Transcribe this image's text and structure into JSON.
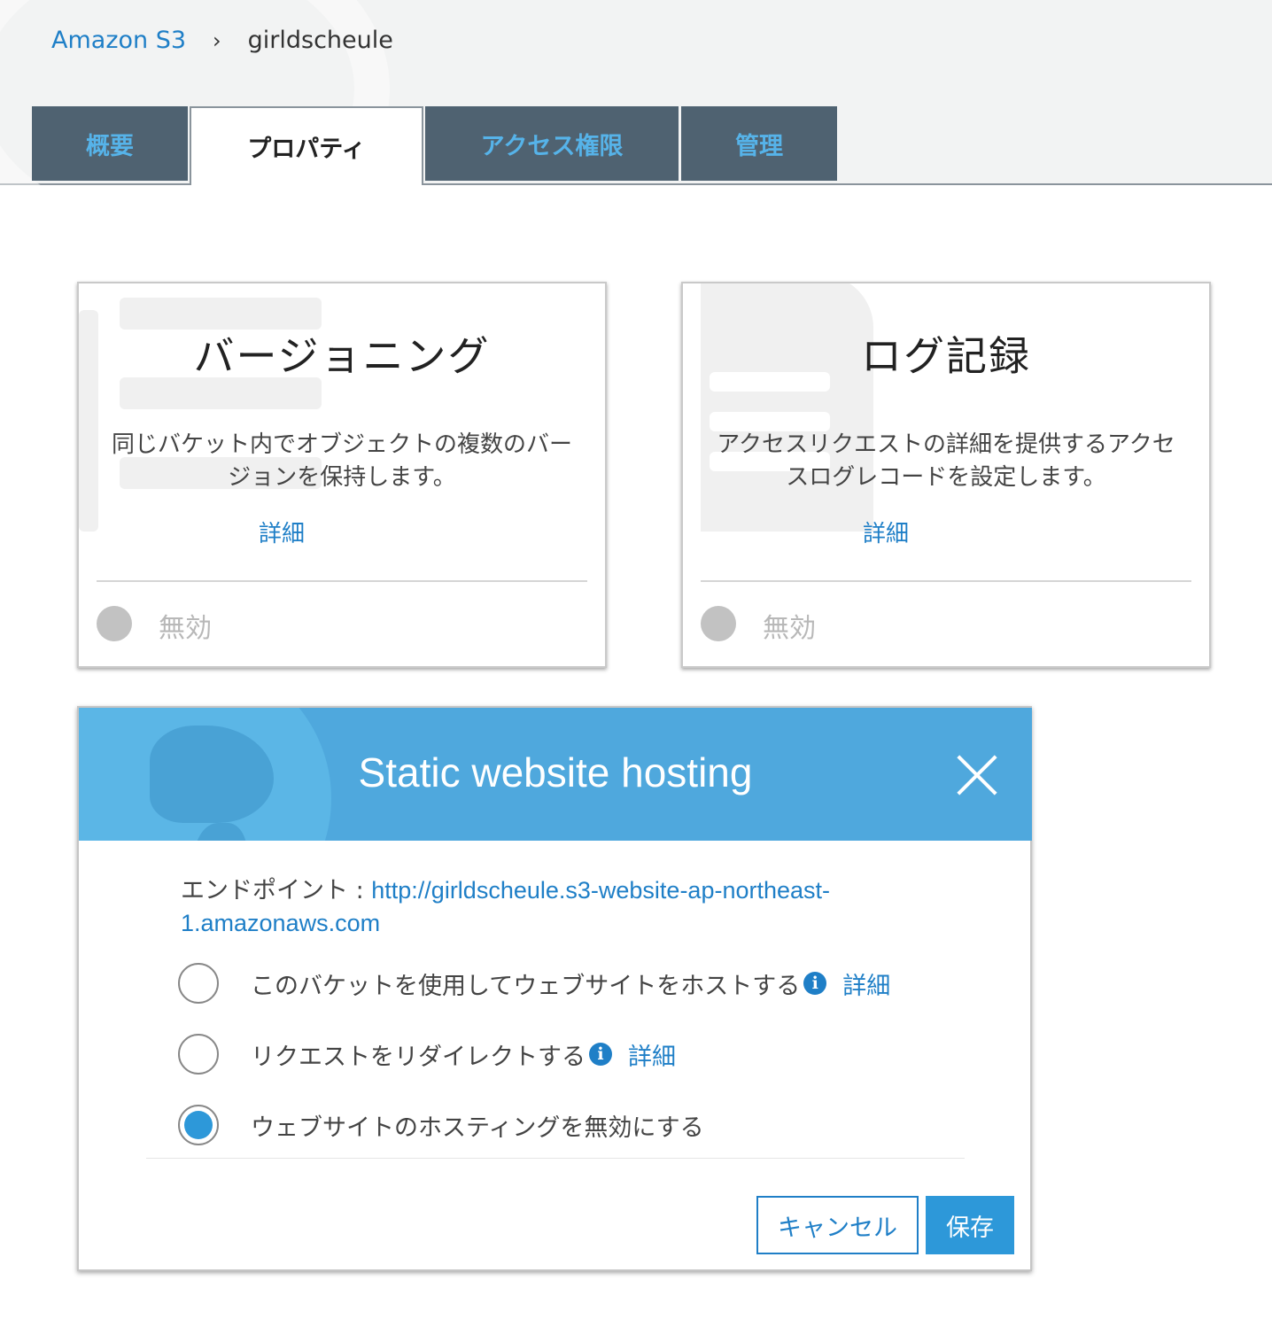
{
  "breadcrumb": {
    "root": "Amazon S3",
    "separator": "›",
    "current": "girldscheule"
  },
  "tabs": [
    {
      "label": "概要",
      "active": false
    },
    {
      "label": "プロパティ",
      "active": true
    },
    {
      "label": "アクセス権限",
      "active": false
    },
    {
      "label": "管理",
      "active": false
    }
  ],
  "cards": {
    "versioning": {
      "title": "バージョニング",
      "description": "同じバケット内でオブジェクトの複数のバージョンを保持します。",
      "more": "詳細",
      "status": "無効"
    },
    "logging": {
      "title": "ログ記録",
      "description": "アクセスリクエストの詳細を提供するアクセスログレコードを設定します。",
      "more": "詳細",
      "status": "無効"
    }
  },
  "modal": {
    "title": "Static website hosting",
    "endpoint_label": "エンドポイント : ",
    "endpoint_url": "http://girldscheule.s3-website-ap-northeast-1.amazonaws.com",
    "options": [
      {
        "label": "このバケットを使用してウェブサイトをホストする",
        "more": "詳細",
        "info_icon": "i",
        "checked": false
      },
      {
        "label": "リクエストをリダイレクトする",
        "more": "詳細",
        "info_icon": "i",
        "checked": false
      },
      {
        "label": "ウェブサイトのホスティングを無効にする",
        "checked": true
      }
    ],
    "cancel_label": "キャンセル",
    "save_label": "保存"
  },
  "colors": {
    "tab_bg": "#4f6271",
    "tab_text": "#56b3e9",
    "link": "#1f7fc7",
    "modal_header": "#4fa8dd",
    "primary_button": "#2d98d9"
  },
  "icons": [
    "chevron-right-icon",
    "close-icon",
    "info-icon",
    "globe-icon",
    "document-icon"
  ]
}
